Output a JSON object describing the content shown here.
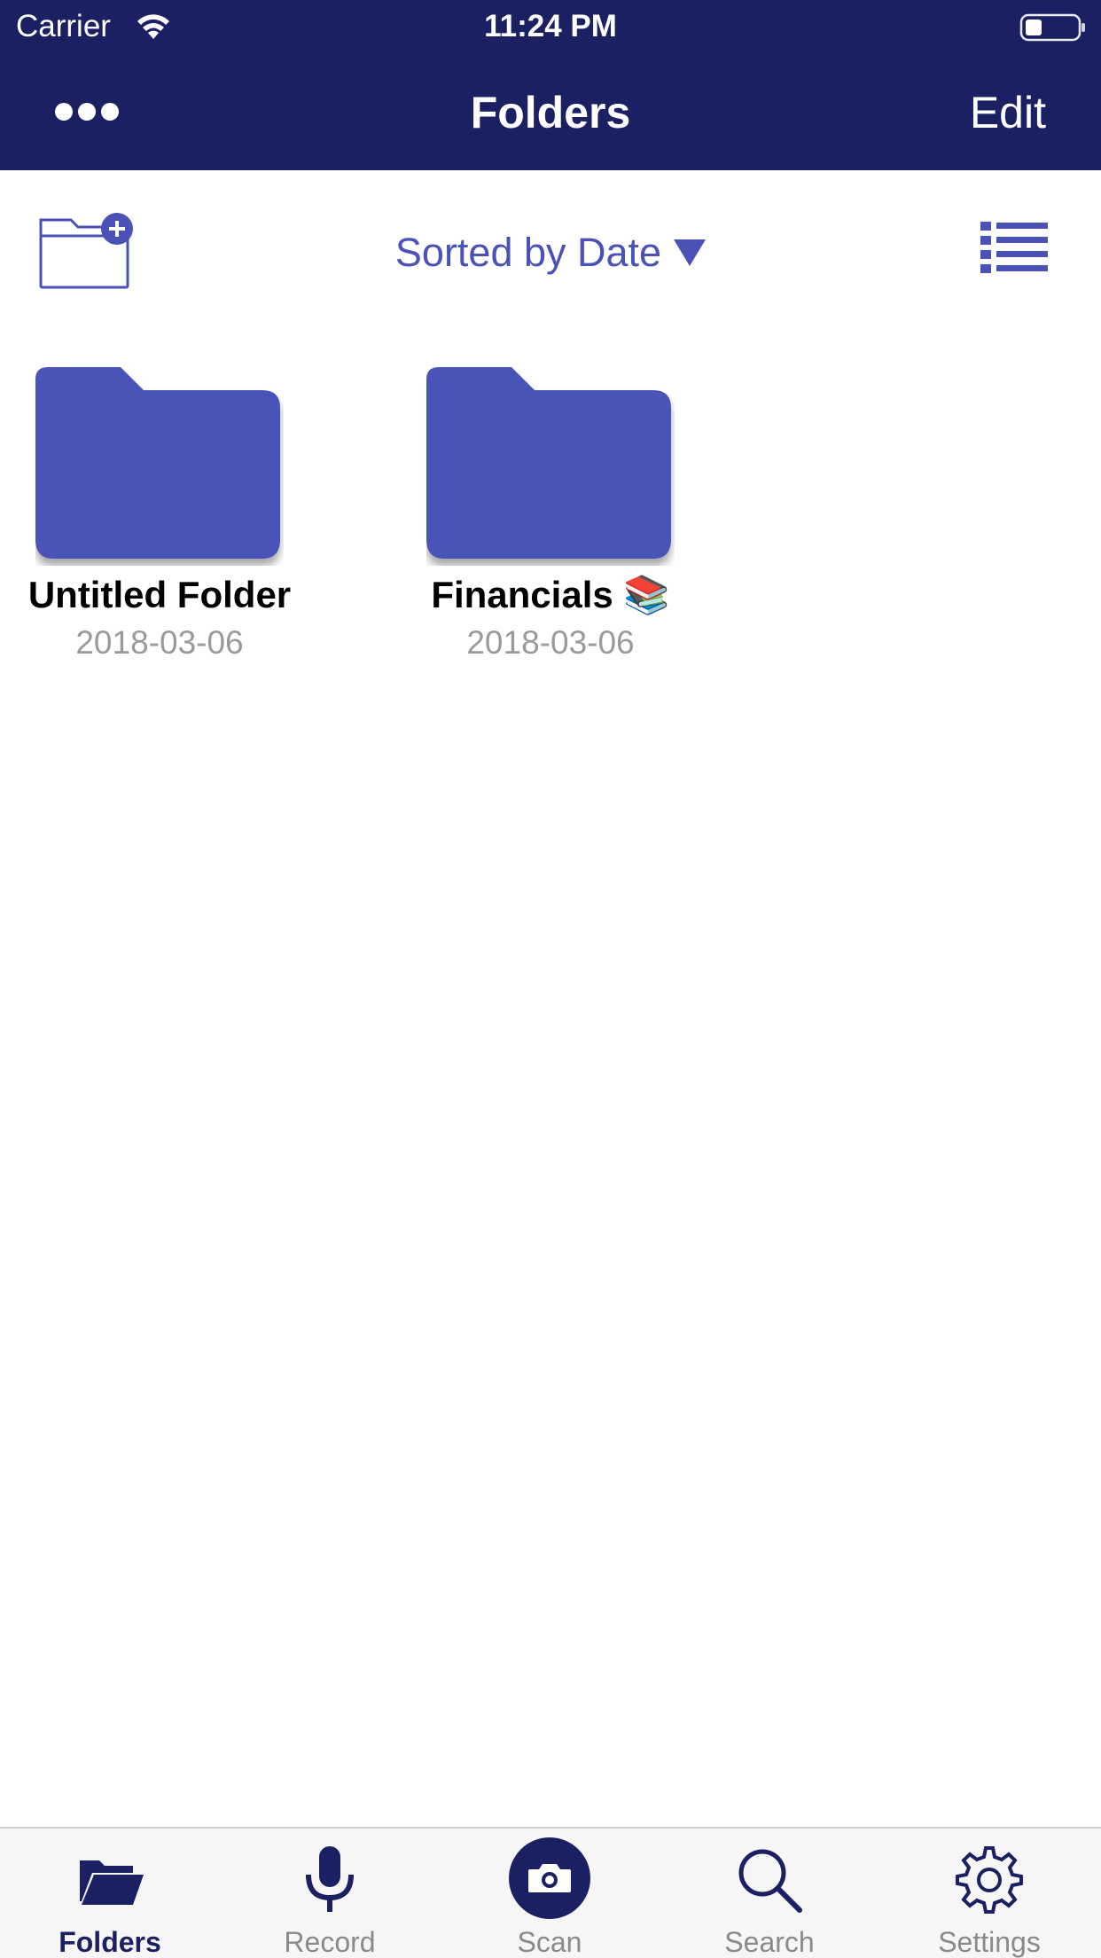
{
  "status_bar": {
    "carrier": "Carrier",
    "time": "11:24 PM"
  },
  "nav": {
    "title": "Folders",
    "edit_label": "Edit",
    "more_icon": "ellipsis-icon"
  },
  "toolbar": {
    "new_folder_icon": "new-folder-icon",
    "sort_label": "Sorted by Date",
    "sort_icon": "caret-down-icon",
    "list_view_icon": "list-view-icon"
  },
  "folders": [
    {
      "name": "Untitled Folder",
      "date": "2018-03-06",
      "emoji": ""
    },
    {
      "name": "Financials 📚",
      "date": "2018-03-06",
      "emoji": "books-emoji"
    }
  ],
  "tabs": [
    {
      "label": "Folders",
      "icon": "folder-icon",
      "active": true
    },
    {
      "label": "Record",
      "icon": "microphone-icon",
      "active": false
    },
    {
      "label": "Scan",
      "icon": "camera-icon",
      "active": false
    },
    {
      "label": "Search",
      "icon": "search-icon",
      "active": false
    },
    {
      "label": "Settings",
      "icon": "gear-icon",
      "active": false
    }
  ],
  "colors": {
    "header_bg": "#1b2062",
    "accent": "#4a52b8",
    "folder_fill": "#4a52b8",
    "date_text": "#9a9a9a",
    "tab_active": "#1b2062",
    "tab_inactive": "#8a8a8a"
  }
}
